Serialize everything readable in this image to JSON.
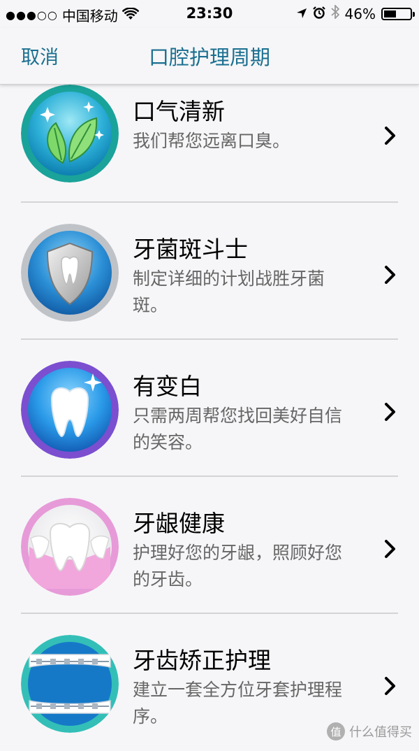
{
  "status_bar": {
    "signal": "●●●○○",
    "carrier": "中国移动",
    "time": "23:30",
    "battery_percent": "46%",
    "battery_level": 0.46
  },
  "nav": {
    "cancel_label": "取消",
    "title": "口腔护理周期"
  },
  "items": [
    {
      "title": "口气清新",
      "description": "我们帮您远离口臭。",
      "icon": "mint-leaves-icon"
    },
    {
      "title": "牙菌斑斗士",
      "description": "制定详细的计划战胜牙菌斑。",
      "icon": "shield-tooth-icon"
    },
    {
      "title": "有变白",
      "description": "只需两周帮您找回美好自信的笑容。",
      "icon": "white-tooth-icon"
    },
    {
      "title": "牙龈健康",
      "description": "护理好您的牙龈，照顾好您的牙齿。",
      "icon": "gums-icon"
    },
    {
      "title": "牙齿矫正护理",
      "description": "建立一套全方位牙套护理程序。",
      "icon": "braces-icon"
    }
  ],
  "watermark": {
    "badge": "值",
    "text": "什么值得买"
  }
}
